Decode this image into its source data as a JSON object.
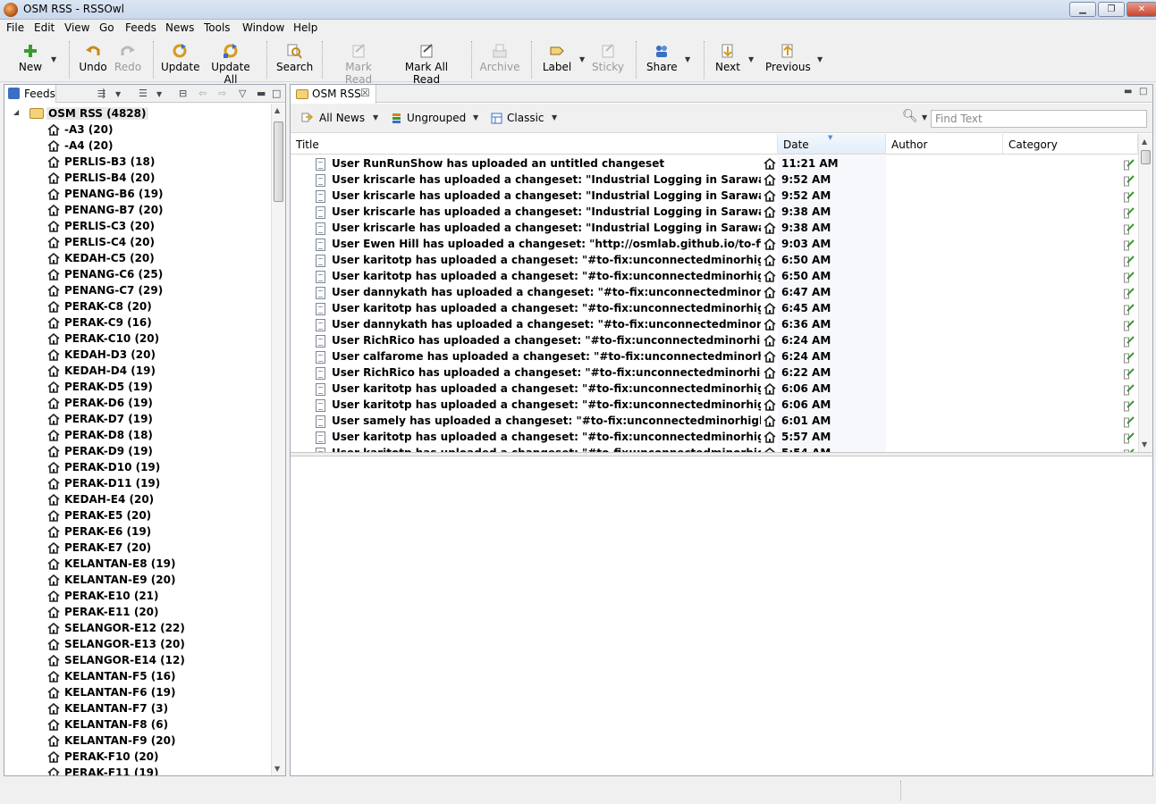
{
  "window": {
    "title": "OSM RSS - RSSOwl",
    "minimize": "▁",
    "maximize": "❐",
    "close": "✕"
  },
  "menu": [
    "File",
    "Edit",
    "View",
    "Go",
    "Feeds",
    "News",
    "Tools",
    "Window",
    "Help"
  ],
  "toolbar": {
    "new": "New",
    "undo": "Undo",
    "redo": "Redo",
    "update": "Update",
    "update_all": "Update All",
    "search": "Search",
    "mark_read": "Mark Read",
    "mark_all_read": "Mark All Read",
    "archive": "Archive",
    "label": "Label",
    "sticky": "Sticky",
    "share": "Share",
    "next": "Next",
    "previous": "Previous"
  },
  "feeds_panel": {
    "tab_label": "Feeds",
    "root": "OSM RSS (4828)",
    "items": [
      "-A3 (20)",
      "-A4 (20)",
      "PERLIS-B3 (18)",
      "PERLIS-B4 (20)",
      "PENANG-B6 (19)",
      "PENANG-B7 (20)",
      "PERLIS-C3 (20)",
      "PERLIS-C4 (20)",
      "KEDAH-C5 (20)",
      "PENANG-C6 (25)",
      "PENANG-C7 (29)",
      "PERAK-C8 (20)",
      "PERAK-C9 (16)",
      "PERAK-C10 (20)",
      "KEDAH-D3 (20)",
      "KEDAH-D4 (19)",
      "PERAK-D5 (19)",
      "PERAK-D6 (19)",
      "PERAK-D7 (19)",
      "PERAK-D8 (18)",
      "PERAK-D9 (19)",
      "PERAK-D10 (19)",
      "PERAK-D11 (19)",
      "KEDAH-E4 (20)",
      "PERAK-E5 (20)",
      "PERAK-E6 (19)",
      "PERAK-E7 (20)",
      "KELANTAN-E8 (19)",
      "KELANTAN-E9 (20)",
      "PERAK-E10 (21)",
      "PERAK-E11 (20)",
      "SELANGOR-E12 (22)",
      "SELANGOR-E13 (20)",
      "SELANGOR-E14 (12)",
      "KELANTAN-F5 (16)",
      "KELANTAN-F6 (19)",
      "KELANTAN-F7 (3)",
      "KELANTAN-F8 (6)",
      "KELANTAN-F9 (20)",
      "PERAK-F10 (20)",
      "PERAK-F11 (19)"
    ]
  },
  "news_panel": {
    "tab_label": "OSM RSS",
    "filter": "All News",
    "grouping": "Ungrouped",
    "layout": "Classic",
    "find_placeholder": "Find Text",
    "columns": {
      "title": "Title",
      "date": "Date",
      "author": "Author",
      "category": "Category"
    },
    "rows": [
      {
        "title": "User RunRunShow has uploaded an untitled changeset",
        "date": "11:21 AM"
      },
      {
        "title": "User kriscarle has uploaded a changeset: \"Industrial Logging in Sarawak, Malaysia #mapping",
        "date": "9:52 AM"
      },
      {
        "title": "User kriscarle has uploaded a changeset: \"Industrial Logging in Sarawak, Malaysia #mapping",
        "date": "9:52 AM"
      },
      {
        "title": "User kriscarle has uploaded a changeset: \"Industrial Logging in Sarawak, Malaysia #mapping",
        "date": "9:38 AM"
      },
      {
        "title": "User kriscarle has uploaded a changeset: \"Industrial Logging in Sarawak, Malaysia #mapping",
        "date": "9:38 AM"
      },
      {
        "title": "User Ewen Hill has uploaded a changeset: \"http://osmlab.github.io/to-fix/#/task/unconnected",
        "date": "9:03 AM"
      },
      {
        "title": "User karitotp has uploaded a changeset: \"#to-fix:unconnectedminorhighways, fixing minor",
        "date": "6:50 AM"
      },
      {
        "title": "User karitotp has uploaded a changeset: \"#to-fix:unconnectedminorhighways, fixing minor",
        "date": "6:50 AM"
      },
      {
        "title": "User dannykath has uploaded a changeset: \"#to-fix:unconnectedminorhighways, fixing minor",
        "date": "6:47 AM"
      },
      {
        "title": "User karitotp has uploaded a changeset: \"#to-fix:unconnectedminorhighways, fixing minor",
        "date": "6:45 AM"
      },
      {
        "title": "User dannykath has uploaded a changeset: \"#to-fix:unconnectedminorhighways, fixing minor",
        "date": "6:36 AM"
      },
      {
        "title": "User RichRico has uploaded a changeset: \"#to-fix:unconnectedminorhighways, fixing minor",
        "date": "6:24 AM"
      },
      {
        "title": "User calfarome has uploaded a changeset: \"#to-fix:unconnectedminorhighways, fixing minor",
        "date": "6:24 AM"
      },
      {
        "title": "User RichRico has uploaded a changeset: \"#to-fix:unconnectedminorhighways, fixing minor",
        "date": "6:22 AM"
      },
      {
        "title": "User karitotp has uploaded a changeset: \"#to-fix:unconnectedminorhighways, fixing minor",
        "date": "6:06 AM"
      },
      {
        "title": "User karitotp has uploaded a changeset: \"#to-fix:unconnectedminorhighways, fixing minor",
        "date": "6:06 AM"
      },
      {
        "title": "User samely has uploaded a changeset: \"#to-fix:unconnectedminorhighways, fixing minor",
        "date": "6:01 AM"
      },
      {
        "title": "User karitotp has uploaded a changeset: \"#to-fix:unconnectedminorhighways, fixing minor",
        "date": "5:57 AM"
      },
      {
        "title": "User karitotp has uploaded a changeset: \"#to-fix:unconnectedminorhighways, fixing minor",
        "date": "5:54 AM"
      }
    ]
  },
  "icons": {
    "new": "plus-icon",
    "undo": "undo-icon",
    "redo": "redo-icon",
    "update": "refresh-icon",
    "update_all": "refresh-all-icon",
    "search": "search-icon",
    "mark_read": "mark-read-icon",
    "mark_all_read": "mark-all-read-icon",
    "archive": "archive-icon",
    "label": "label-icon",
    "sticky": "sticky-icon",
    "share": "share-icon",
    "next": "next-icon",
    "previous": "previous-icon"
  },
  "colors": {
    "accent": "#3a6fc4",
    "sorted_column": "#e3eef9",
    "disabled_text": "#9a9a9a"
  }
}
